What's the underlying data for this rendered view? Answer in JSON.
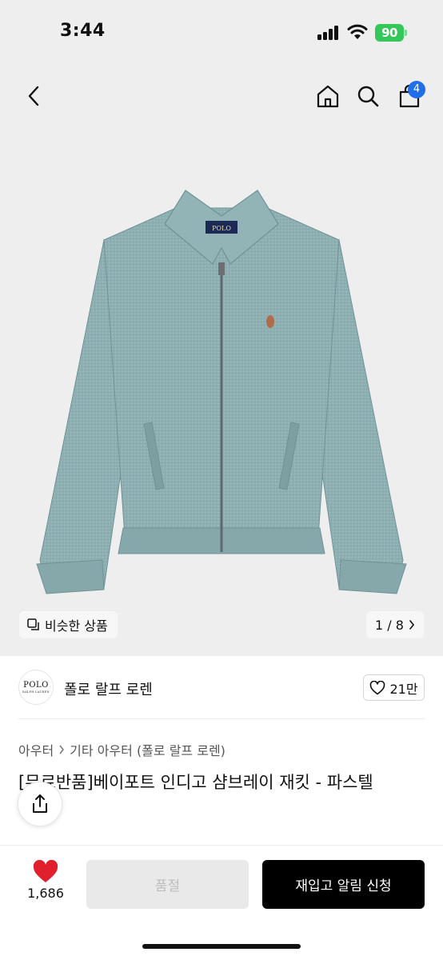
{
  "status_bar": {
    "time": "3:44",
    "battery": "90"
  },
  "nav": {
    "cart_count": "4"
  },
  "gallery": {
    "similar_label": "비슷한 상품",
    "pager": "1 / 8"
  },
  "brand": {
    "logo_text": "POLO",
    "logo_sub": "RALPH LAUREN",
    "name": "폴로 랄프 로렌",
    "likes": "21만"
  },
  "breadcrumb": [
    "아우터",
    "기타 아우터 (폴로 랄프 로렌)"
  ],
  "product": {
    "title": "[무료반품]베이포트 인디고 샴브레이 재킷 - 파스텔"
  },
  "bottom_bar": {
    "wish_count": "1,686",
    "soldout_label": "품절",
    "restock_label": "재입고 알림 신청"
  },
  "colors": {
    "accent_badge": "#1f6feb",
    "heart": "#e0212d",
    "battery": "#34c759",
    "jacket": "#8fb0b3"
  }
}
